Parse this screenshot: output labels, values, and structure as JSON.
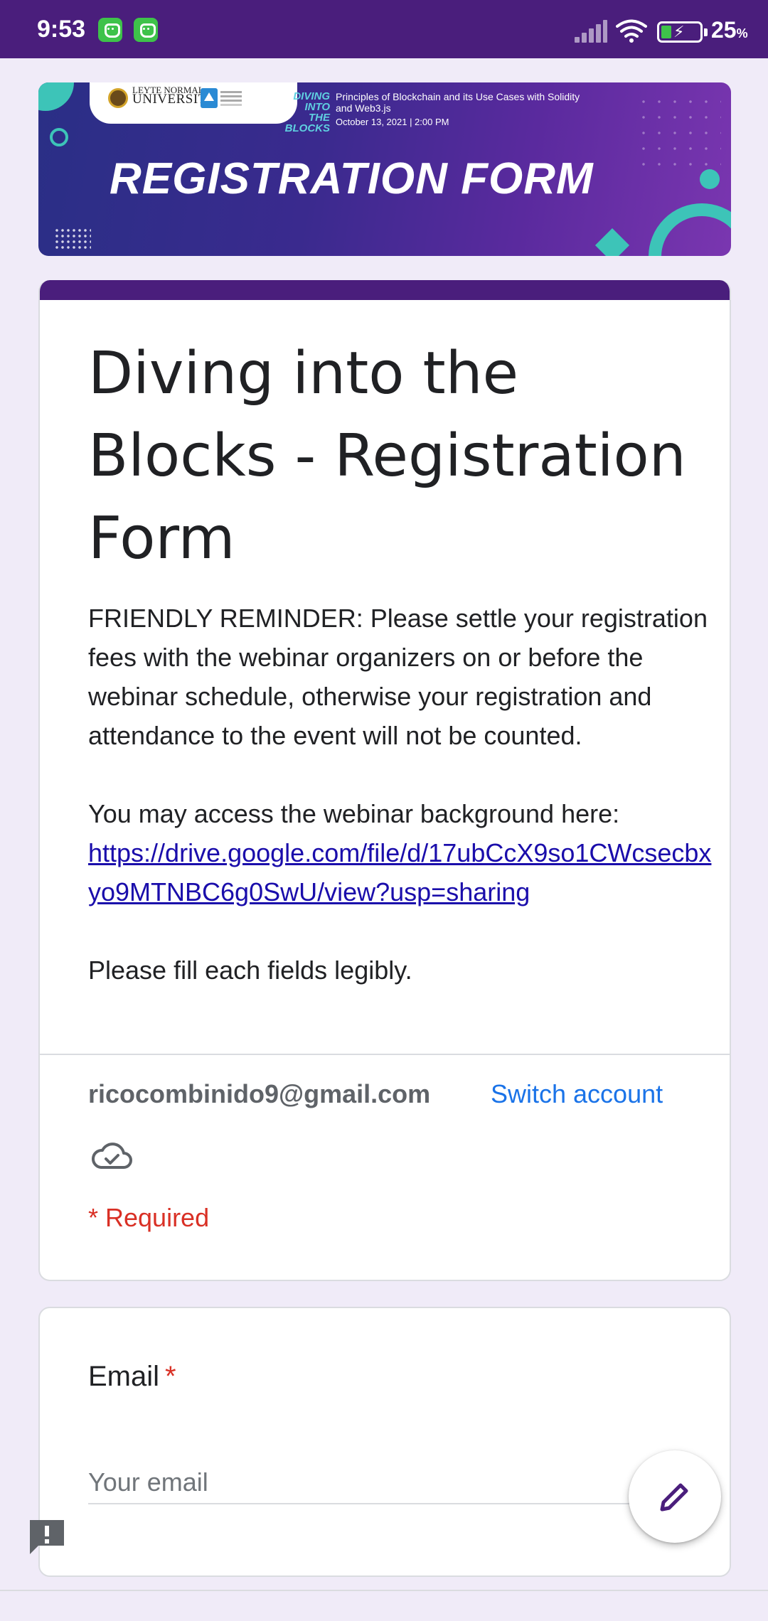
{
  "status_bar": {
    "time": "9:53",
    "battery_pct": "25",
    "battery_unit": "%",
    "icons": [
      "app-notification-icon",
      "app-notification-icon",
      "signal-icon",
      "wifi-icon",
      "battery-charging-icon"
    ]
  },
  "banner": {
    "university_line1": "LEYTE NORMAL",
    "university_line2": "UNIVERSITY",
    "brand_line1": "DIVING",
    "brand_line2": "INTO",
    "brand_line3": "THE",
    "brand_line4": "BLOCKS",
    "event_title": "Principles of Blockchain and its Use Cases with Solidity and Web3.js",
    "event_date": "October 13, 2021 | 2:00 PM",
    "heading": "REGISTRATION FORM"
  },
  "form": {
    "title": "Diving into the Blocks - Registration Form",
    "reminder": "FRIENDLY REMINDER: Please settle your registration fees with the webinar organizers on or before the webinar schedule, otherwise your registration and attendance to the event will not be counted.",
    "access_text": "You may access the webinar background here:",
    "link": "https://drive.google.com/file/d/17ubCcX9so1CWcsecbxyo9MTNBC6g0SwU/view?usp=sharing",
    "fill_note": "Please fill each fields legibly.",
    "account_email": "ricocombinido9@gmail.com",
    "switch_account": "Switch account",
    "required_note": "* Required"
  },
  "email_question": {
    "label": "Email",
    "required_mark": "*",
    "placeholder": "Your email"
  },
  "colors": {
    "theme": "#4a1e7c",
    "background": "#f0ebf8",
    "link": "#1a0dab",
    "switch_account": "#1a73e8",
    "required": "#d93025"
  }
}
